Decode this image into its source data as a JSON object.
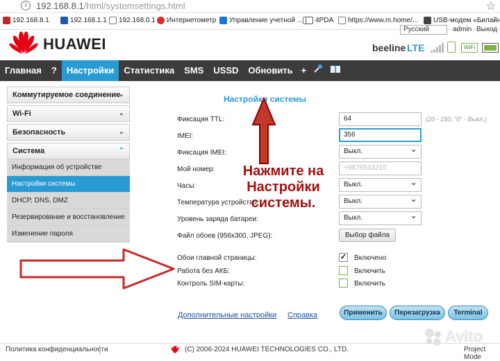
{
  "browser": {
    "url_host": "192.168.8.1",
    "url_path": "/html/systemsettings.html",
    "bookmarks": [
      {
        "label": "192.168.8.1",
        "color": "#c62828"
      },
      {
        "label": "192.168.1.1",
        "color": "#1e5aa8"
      },
      {
        "label": "192.168.0.1",
        "color": "#555555"
      },
      {
        "label": "Интернетометр",
        "color": "#d32f2f"
      },
      {
        "label": "Управление учетной ...",
        "color": "#1976d2"
      },
      {
        "label": "",
        "color": "#777777"
      },
      {
        "label": "4PDA",
        "color": "#555555"
      },
      {
        "label": "https://www.m.home/...",
        "color": "#555555"
      },
      {
        "label": "USB-модем «Билайн»",
        "color": "#444444"
      }
    ]
  },
  "header": {
    "brand": "HUAWEI",
    "language": "Русский",
    "user": "admin",
    "exit": "Выход",
    "operator": "beeline",
    "network_type": "LTE",
    "wifi_badge": "WiFi",
    "signal_bars": 5,
    "battery_level": 0.9
  },
  "nav": {
    "items": [
      "Главная",
      "?",
      "Настройки",
      "Статистика",
      "SMS",
      "USSD",
      "Обновить",
      "+"
    ],
    "active": "Настройки"
  },
  "sidebar": {
    "groups": [
      {
        "label": "Коммутируемое соединение",
        "chevron": "⌄"
      },
      {
        "label": "Wi-Fi",
        "chevron": "⌄"
      },
      {
        "label": "Безопасность",
        "chevron": "⌄"
      },
      {
        "label": "Система",
        "chevron": "⌃"
      }
    ],
    "sub_items": [
      "Информация об устройстве",
      "Настройки системы",
      "DHCP, DNS, DMZ",
      "Резервирование и восстановление",
      "Изменение пароля"
    ],
    "active_sub": "Настройки системы"
  },
  "main": {
    "title": "Настройки системы",
    "fields": {
      "ttl": {
        "label": "Фиксация TTL:",
        "value": "64",
        "hint": "(20 - 150, \"0\" - Выкл.)"
      },
      "imei": {
        "label": "IMEI:",
        "value": "356"
      },
      "imei_fix": {
        "label": "Фиксация IMEI:",
        "value": "Выкл."
      },
      "my_number": {
        "label": "Мой номер:",
        "placeholder": "+9876543210"
      },
      "clock": {
        "label": "Часы:",
        "value": "Выкл."
      },
      "temperature": {
        "label": "Температура устройства:",
        "value": "Выкл."
      },
      "battery_level": {
        "label": "Уровень заряда батареи:",
        "value": "Выкл."
      },
      "wallpaper": {
        "label": "Файл обоев (956x300, JPEG):",
        "button": "Выбор файла"
      }
    },
    "checkboxes": [
      {
        "label": "Обои главной страницы:",
        "state_label": "Включено",
        "checked": true
      },
      {
        "label": "Работа без АКБ:",
        "state_label": "Включить",
        "checked": false
      },
      {
        "label": "Контроль SIM-карты:",
        "state_label": "Включить",
        "checked": false
      }
    ],
    "links": {
      "advanced": "Дополнительные настройки",
      "help": "Справка"
    },
    "buttons": {
      "apply": "Применить",
      "reboot": "Перезагрузка",
      "terminal": "Terminal"
    },
    "annotation": "Нажмите на Настройки системы."
  },
  "footer": {
    "privacy": "Политика конфиденциальности",
    "copyright": "(C) 2006-2024 HUAWEI TECHNOLOGIES CO., LTD.",
    "project": "Project Mode"
  },
  "watermark": "Avito",
  "colors": {
    "accent": "#2a9bd2",
    "nav_bg": "#3c3c3c",
    "annotation": "#a01010",
    "huawei_red": "#e60012"
  }
}
